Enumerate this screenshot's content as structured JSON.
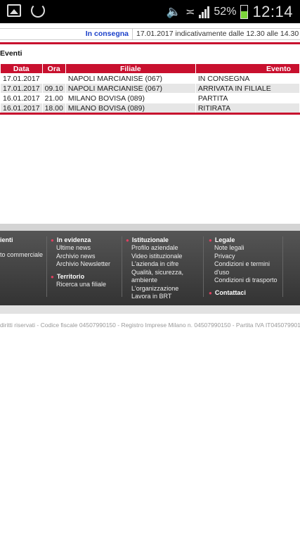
{
  "status_bar": {
    "battery_percent": "52%",
    "time": "12:14"
  },
  "delivery_status": {
    "label": "In consegna",
    "text": "17.01.2017 indicativamente dalle 12.30 alle 14.30"
  },
  "events": {
    "title": "Eventi",
    "headers": {
      "data": "Data",
      "ora": "Ora",
      "filiale": "Filiale",
      "evento": "Evento"
    },
    "rows": [
      {
        "data": "17.01.2017",
        "ora": "",
        "filiale": "NAPOLI MARCIANISE (067)",
        "evento": "IN CONSEGNA"
      },
      {
        "data": "17.01.2017",
        "ora": "09.10",
        "filiale": "NAPOLI MARCIANISE (067)",
        "evento": "ARRIVATA IN FILIALE"
      },
      {
        "data": "16.01.2017",
        "ora": "21.00",
        "filiale": "MILANO BOVISA (089)",
        "evento": "PARTITA"
      },
      {
        "data": "16.01.2017",
        "ora": "18.00",
        "filiale": "MILANO BOVISA (089)",
        "evento": "RITIRATA"
      }
    ]
  },
  "footer": {
    "col1": {
      "heading": "ienti",
      "items": [
        "to commerciale"
      ]
    },
    "col2": {
      "heading": "In evidenza",
      "items": [
        "Ultime news",
        "Archivio news",
        "Archivio Newsletter"
      ],
      "sub_heading": "Territorio",
      "sub_items": [
        "Ricerca una filiale"
      ]
    },
    "col3": {
      "heading": "Istituzionale",
      "items": [
        "Profilo aziendale",
        "Video istituzionale",
        "L'azienda in cifre",
        "Qualità, sicurezza,",
        "ambiente",
        "L'organizzazione",
        "Lavora in BRT"
      ]
    },
    "col4": {
      "heading": "Legale",
      "items": [
        "Note legali",
        "Privacy",
        "Condizioni e termini",
        "d'uso",
        "Condizioni di trasporto"
      ],
      "sub_heading": "Contattaci"
    }
  },
  "legal_text": "diritti riservati - Codice fiscale 04507990150 - Registro Imprese Milano n. 04507990150 - Partita IVA IT04507990150",
  "colors": {
    "brand_red": "#c8102e",
    "link_blue": "#1a3fc9"
  }
}
